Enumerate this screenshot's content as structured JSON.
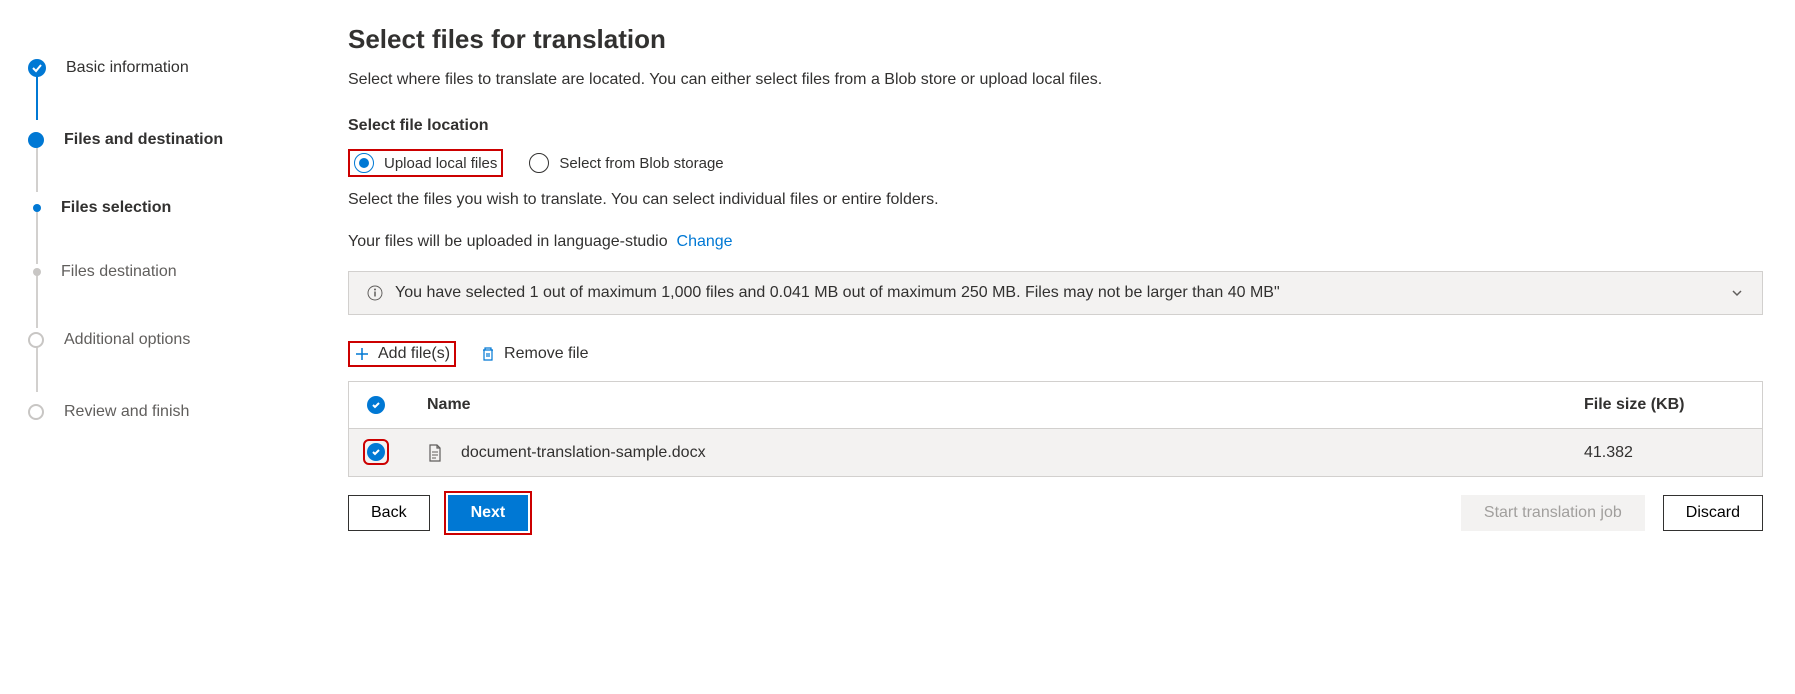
{
  "stepper": {
    "items": [
      {
        "label": "Basic information",
        "state": "done"
      },
      {
        "label": "Files and destination",
        "state": "active"
      },
      {
        "label": "Files selection",
        "state": "sub-active"
      },
      {
        "label": "Files destination",
        "state": "sub-pending"
      },
      {
        "label": "Additional options",
        "state": "pending"
      },
      {
        "label": "Review and finish",
        "state": "pending"
      }
    ]
  },
  "main": {
    "title": "Select files for translation",
    "subtitle": "Select where files to translate are located. You can either select files from a Blob store or upload local files.",
    "section_label": "Select file location",
    "radios": {
      "upload": "Upload local files",
      "blob": "Select from Blob storage"
    },
    "helper": "Select the files you wish to translate. You can select individual files or entire folders.",
    "upload_text_prefix": "Your files will be uploaded in language-studio",
    "change_link": "Change",
    "banner": "You have selected 1 out of maximum 1,000 files and 0.041 MB out of maximum 250 MB. Files may not be larger than 40 MB\"",
    "toolbar": {
      "add": "Add file(s)",
      "remove": "Remove file"
    },
    "table": {
      "headers": {
        "name": "Name",
        "size": "File size (KB)"
      },
      "rows": [
        {
          "name": "document-translation-sample.docx",
          "size": "41.382"
        }
      ]
    }
  },
  "footer": {
    "back": "Back",
    "next": "Next",
    "start": "Start translation job",
    "discard": "Discard"
  }
}
